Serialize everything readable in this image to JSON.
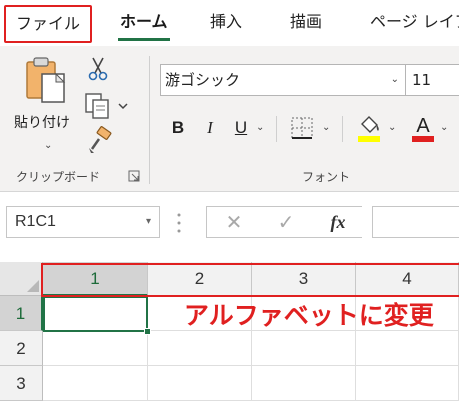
{
  "tabs": {
    "file": "ファイル",
    "home": "ホーム",
    "insert": "挿入",
    "draw": "描画",
    "page_layout": "ページ レイア"
  },
  "ribbon": {
    "clipboard": {
      "paste_label": "貼り付け",
      "group_label": "クリップボード",
      "icons": [
        "paste-icon",
        "cut-icon",
        "copy-icon",
        "format-painter-icon",
        "dialog-launcher-icon"
      ]
    },
    "font": {
      "font_name": "游ゴシック",
      "font_size": "11",
      "bold": "B",
      "italic": "I",
      "underline": "U",
      "group_label": "フォント",
      "fill_color": "#ffff00",
      "font_color": "#e02020"
    }
  },
  "formula_bar": {
    "name_box": "R1C1",
    "fx_label": "fx",
    "cancel_icon": "✕",
    "enter_icon": "✓",
    "formula_value": ""
  },
  "grid": {
    "column_headers": [
      "1",
      "2",
      "3",
      "4"
    ],
    "row_headers": [
      "1",
      "2",
      "3"
    ],
    "active_cell": "R1C1"
  },
  "annotation": {
    "text": "アルファベットに変更",
    "color": "#e02020"
  },
  "colors": {
    "accent_green": "#217346",
    "highlight_red": "#e02020"
  }
}
